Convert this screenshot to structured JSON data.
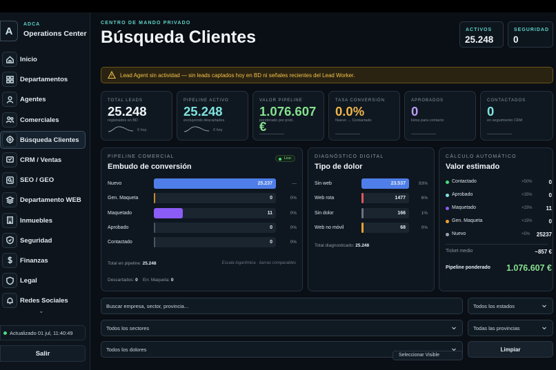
{
  "brand": {
    "logo": "A",
    "small": "ADCA",
    "big": "Operations Center"
  },
  "nav": [
    {
      "label": "Inicio",
      "icon": "home-icon"
    },
    {
      "label": "Departamentos",
      "icon": "grid-icon"
    },
    {
      "label": "Agentes",
      "icon": "agent-icon"
    },
    {
      "label": "Comerciales",
      "icon": "users-icon"
    },
    {
      "label": "Búsqueda Clientes",
      "icon": "target-icon",
      "active": true
    },
    {
      "label": "CRM / Ventas",
      "icon": "crm-icon"
    },
    {
      "label": "SEO / GEO",
      "icon": "search-icon"
    },
    {
      "label": "Departamento WEB",
      "icon": "layers-icon"
    },
    {
      "label": "Inmuebles",
      "icon": "building-icon"
    },
    {
      "label": "Seguridad",
      "icon": "shield-icon"
    },
    {
      "label": "Finanzas",
      "icon": "dollar-icon"
    },
    {
      "label": "Legal",
      "icon": "legal-icon"
    },
    {
      "label": "Redes Sociales",
      "icon": "bell-icon"
    }
  ],
  "sidebar": {
    "status": "Actualizado 01 jul, 11:40:49",
    "logout": "Salir",
    "scroll_icon": "chevron-down-icon"
  },
  "header": {
    "eyebrow": "CENTRO DE MANDO PRIVADO",
    "title": "Búsqueda Clientes",
    "stats": [
      {
        "label": "ACTIVOS",
        "value": "25.248"
      },
      {
        "label": "SEGURIDAD",
        "value": "0"
      }
    ]
  },
  "alert": {
    "text": "Lead Agent sin actividad — sin leads captados hoy en BD ni señales recientes del Lead Worker.",
    "icon": "warning-icon"
  },
  "kpis": [
    {
      "label": "TOTAL LEADS",
      "value": "25.248",
      "sub": "registrados en BD",
      "hint": "0 hoy",
      "color": "#f1f5f9",
      "spark": true
    },
    {
      "label": "PIPELINE ACTIVO",
      "value": "25.248",
      "sub": "excluyendo descartados",
      "hint": "0 hoy",
      "color": "#7fe3e0",
      "spark": true
    },
    {
      "label": "VALOR PIPELINE",
      "value": "1.076.607 €",
      "sub": "ponderado por prob.",
      "hint": "",
      "color": "#86e08f",
      "spark": false
    },
    {
      "label": "TASA CONVERSIÓN",
      "value": "0.0%",
      "sub": "Nuevo → Contactado",
      "hint": "",
      "color": "#f1b54a",
      "spark": false
    },
    {
      "label": "APROBADOS",
      "value": "0",
      "sub": "listos para contacto",
      "hint": "",
      "color": "#b79cf5",
      "spark": false
    },
    {
      "label": "CONTACTADOS",
      "value": "0",
      "sub": "en seguimiento CRM",
      "hint": "",
      "color": "#7fe3e0",
      "spark": false
    }
  ],
  "funnel": {
    "eyebrow": "PIPELINE COMERCIAL",
    "title": "Embudo de conversión",
    "badge": "Live",
    "rows": [
      {
        "label": "Nuevo",
        "value": "25.237",
        "pct": "—",
        "frac": 1.0,
        "color": "#4f7ee8"
      },
      {
        "label": "Gen. Maqueta",
        "value": "0",
        "pct": "0%",
        "frac": 0.012,
        "color": "#c98a2a"
      },
      {
        "label": "Maquetado",
        "value": "11",
        "pct": "0%",
        "frac": 0.24,
        "color": "#8b5cf6"
      },
      {
        "label": "Aprobado",
        "value": "0",
        "pct": "0%",
        "frac": 0.012,
        "color": "#4b5563"
      },
      {
        "label": "Contactado",
        "value": "0",
        "pct": "0%",
        "frac": 0.012,
        "color": "#4b5563"
      }
    ],
    "total_label": "Total en pipeline:",
    "total_value": "25.248",
    "note": "Escala logarítmica · barras comparables",
    "discarded_label": "Descartados:",
    "discarded_value": "0",
    "err_label": "Err. Maqueta:",
    "err_value": "0"
  },
  "diagnostic": {
    "eyebrow": "DIAGNÓSTICO DIGITAL",
    "title": "Tipo de dolor",
    "rows": [
      {
        "label": "Sin web",
        "value": "23.537",
        "pct": "93%",
        "frac": 1.0,
        "color": "#4f7ee8"
      },
      {
        "label": "Web rota",
        "value": "1477",
        "pct": "6%",
        "frac": 0.04,
        "color": "#e05a5a"
      },
      {
        "label": "Sin dolor",
        "value": "166",
        "pct": "1%",
        "frac": 0.04,
        "color": "#6b7280"
      },
      {
        "label": "Web no móvil",
        "value": "68",
        "pct": "0%",
        "frac": 0.04,
        "color": "#f0a030"
      }
    ],
    "total_label": "Total diagnosticado:",
    "total_value": "25.248"
  },
  "calc": {
    "eyebrow": "CÁLCULO AUTOMÁTICO",
    "title": "Valor estimado",
    "rows": [
      {
        "label": "Contactado",
        "mult": "×50%",
        "value": "0",
        "color": "#4ade80"
      },
      {
        "label": "Aprobado",
        "mult": "×35%",
        "value": "0",
        "color": "#7fe3e0"
      },
      {
        "label": "Maquetado",
        "mult": "×25%",
        "value": "11",
        "color": "#8b5cf6"
      },
      {
        "label": "Gen. Maqueta",
        "mult": "×15%",
        "value": "0",
        "color": "#f0a030"
      },
      {
        "label": "Nuevo",
        "mult": "×5%",
        "value": "25237",
        "color": "#9ca3af"
      }
    ],
    "ticket_label": "Ticket medio",
    "ticket_value": "~857 €",
    "pipeline_label": "Pipeline ponderado",
    "pipeline_value": "1.076.607 €",
    "pipeline_color": "#86e08f"
  },
  "filters": {
    "search_placeholder": "Buscar empresa, sector, provincia...",
    "states": "Todos los estados",
    "sectors": "Todos los sectores",
    "provinces": "Todas las provincias",
    "pains": "Todos los dolores",
    "clear": "Limpiar",
    "peek": "Seleccionar Visible"
  },
  "colors": {
    "accent": "#5fd1c8",
    "warning": "#f3c34a",
    "bg": "#0a0f15"
  }
}
